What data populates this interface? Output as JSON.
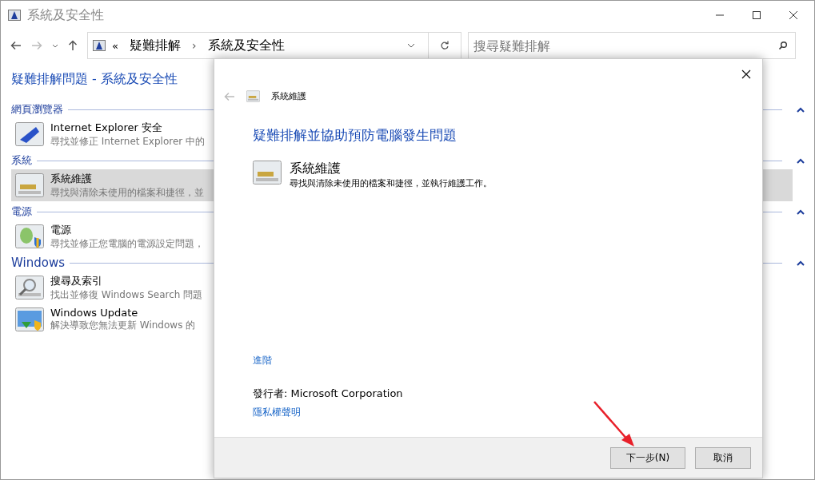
{
  "window": {
    "title": "系統及安全性"
  },
  "address": {
    "overflow": "«",
    "crumbs": [
      "疑難排解",
      "系統及安全性"
    ],
    "separator": "›"
  },
  "search": {
    "placeholder": "搜尋疑難排解"
  },
  "page_title": "疑難排解問題 - 系統及安全性",
  "sections": [
    {
      "heading": "網頁瀏覽器",
      "items": [
        {
          "kind": "browser",
          "title": "Internet Explorer 安全",
          "description": "尋找並修正 Internet Explorer 中的",
          "selected": false
        }
      ]
    },
    {
      "heading": "系統",
      "items": [
        {
          "kind": "maintenance",
          "title": "系統維護",
          "description": "尋找與清除未使用的檔案和捷徑，並",
          "selected": true
        }
      ]
    },
    {
      "heading": "電源",
      "items": [
        {
          "kind": "power",
          "title": "電源",
          "description": "尋找並修正您電腦的電源設定問題，",
          "selected": false
        }
      ]
    },
    {
      "heading": "Windows",
      "items": [
        {
          "kind": "search",
          "title": "搜尋及索引",
          "description": "找出並修復 Windows Search 問題",
          "selected": false
        },
        {
          "kind": "update",
          "title": "Windows Update",
          "description": "解決導致您無法更新 Windows 的",
          "selected": false
        }
      ]
    }
  ],
  "dialog": {
    "header": "系統維護",
    "heading": "疑難排解並協助預防電腦發生問題",
    "item_title": "系統維護",
    "item_description": "尋找與清除未使用的檔案和捷徑，並執行維護工作。",
    "advanced_link": "進階",
    "publisher": "發行者:  Microsoft Corporation",
    "privacy_link": "隱私權聲明",
    "buttons": [
      {
        "label": "下一步(N)",
        "kind": "primary"
      },
      {
        "label": "取消",
        "kind": "cancel"
      }
    ]
  }
}
